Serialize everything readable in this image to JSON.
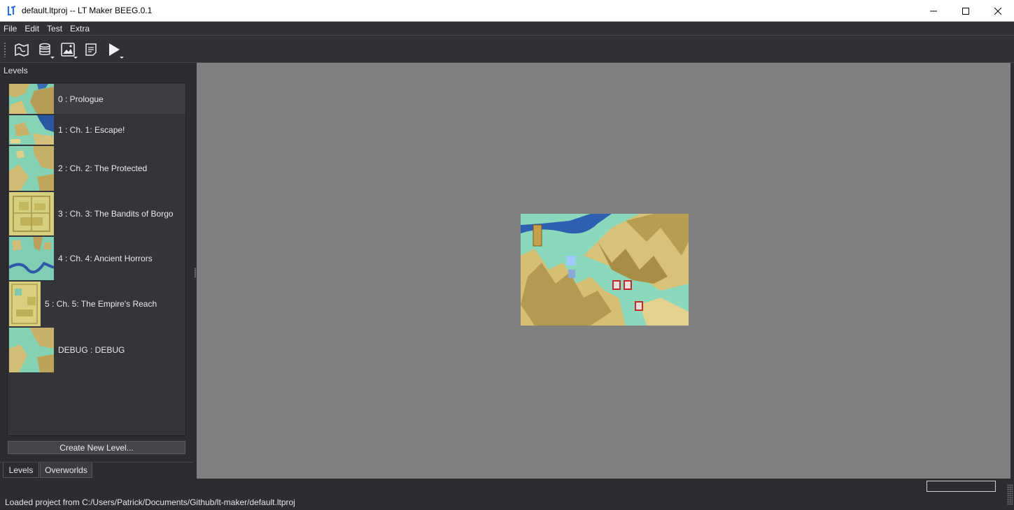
{
  "window": {
    "title": "default.ltproj -- LT Maker BEEG.0.1",
    "icon": "lt-maker-logo-icon",
    "controls": [
      "minimize-icon",
      "maximize-icon",
      "close-icon"
    ]
  },
  "menu": {
    "items": [
      {
        "label": "File"
      },
      {
        "label": "Edit"
      },
      {
        "label": "Test"
      },
      {
        "label": "Extra"
      }
    ]
  },
  "toolbar": {
    "tools": [
      {
        "icon": "map-icon"
      },
      {
        "icon": "database-icon"
      },
      {
        "icon": "image-icon"
      },
      {
        "icon": "notes-icon"
      },
      {
        "icon": "play-icon"
      }
    ]
  },
  "levels_panel": {
    "title": "Levels",
    "levels": [
      {
        "label": "0 : Prologue",
        "selected": true
      },
      {
        "label": "1 : Ch. 1: Escape!",
        "selected": false
      },
      {
        "label": "2 : Ch. 2: The Protected",
        "selected": false
      },
      {
        "label": "3 : Ch. 3: The Bandits of Borgo",
        "selected": false
      },
      {
        "label": "4 : Ch. 4: Ancient Horrors",
        "selected": false
      },
      {
        "label": "5 : Ch. 5: The Empire's Reach",
        "selected": false
      },
      {
        "label": "DEBUG : DEBUG",
        "selected": false
      }
    ],
    "create_button": "Create New Level...",
    "tabs": [
      {
        "label": "Levels",
        "active": true
      },
      {
        "label": "Overworlds",
        "active": false
      }
    ]
  },
  "status": {
    "message": "Loaded project from C:/Users/Patrick/Documents/Github/lt-maker/default.ltproj"
  },
  "colors": {
    "accent_blue": "#2f6fdb",
    "panel_bg": "#2b2d31",
    "canvas_bg": "#808080"
  }
}
